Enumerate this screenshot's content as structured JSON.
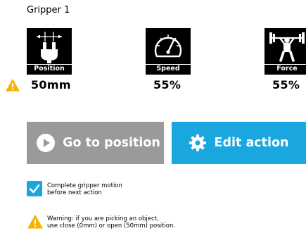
{
  "title": "Gripper 1",
  "tiles": [
    {
      "label": "Position",
      "value": "50mm",
      "icon": "gripper-icon"
    },
    {
      "label": "Speed",
      "value": "55%",
      "icon": "speedometer-icon"
    },
    {
      "label": "Force",
      "value": "55%",
      "icon": "weightlifter-icon"
    }
  ],
  "buttons": {
    "go_to_position": "Go to position",
    "edit_action": "Edit action"
  },
  "checkbox": {
    "checked": true,
    "line1": "Complete gripper motion",
    "line2": "before next action"
  },
  "warning": {
    "line1": "Warning: if you are picking an object,",
    "line2": "use close (0mm) or open (50mm) position."
  },
  "colors": {
    "accent": "#1aa7e0",
    "disabled_button": "#9a9a9a",
    "warning": "#f5b400"
  }
}
